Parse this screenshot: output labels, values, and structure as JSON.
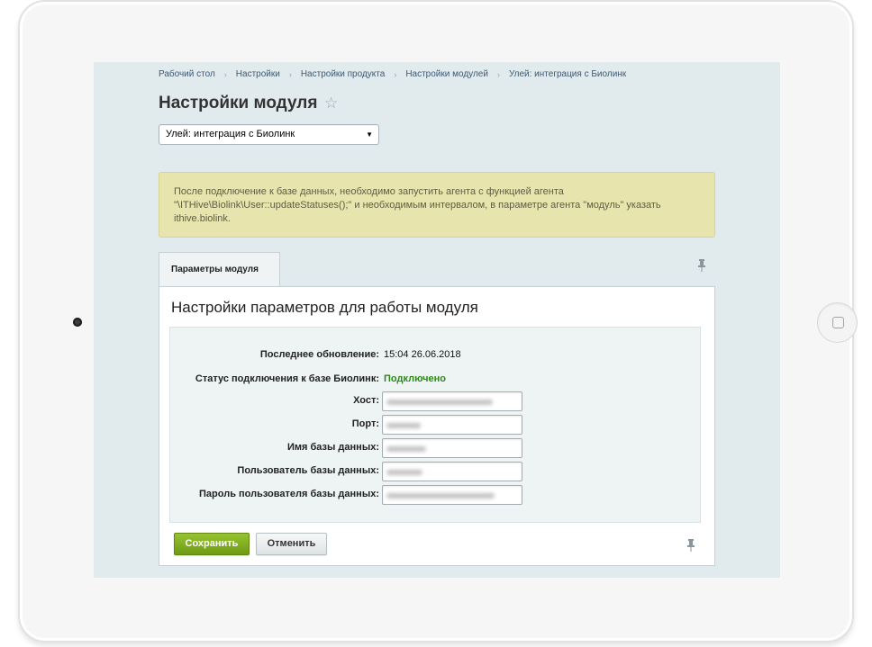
{
  "breadcrumb": {
    "items": [
      "Рабочий стол",
      "Настройки",
      "Настройки продукта",
      "Настройки модулей",
      "Улей: интеграция с Биолинк"
    ],
    "separator": "›"
  },
  "page": {
    "title": "Настройки модуля",
    "star_icon": "☆"
  },
  "module_select": {
    "value": "Улей: интеграция с Биолинк",
    "arrow": "▼"
  },
  "notice": {
    "text": "После подключение к базе данных, необходимо запустить агента с функцией агента \"\\ITHive\\Biolink\\User::updateStatuses();\" и необходимым интервалом, в параметре агента \"модуль\" указать ithive.biolink."
  },
  "tabs": [
    {
      "label": "Параметры модуля"
    }
  ],
  "panel": {
    "title": "Настройки параметров для работы модуля"
  },
  "form": {
    "last_update": {
      "label": "Последнее обновление:",
      "value": "15:04 26.06.2018"
    },
    "status": {
      "label": "Статус подключения к базе Биолинк:",
      "value": "Подключено"
    },
    "host": {
      "label": "Хост:",
      "value": ""
    },
    "port": {
      "label": "Порт:",
      "value": ""
    },
    "db_name": {
      "label": "Имя базы данных:",
      "value": ""
    },
    "db_user": {
      "label": "Пользователь базы данных:",
      "value": ""
    },
    "db_password": {
      "label": "Пароль пользователя базы данных:",
      "value": ""
    }
  },
  "buttons": {
    "save": "Сохранить",
    "cancel": "Отменить"
  },
  "colors": {
    "screen_bg": "#e1eaed",
    "notice_bg": "#e7e5ad",
    "status_ok": "#2b8a17",
    "save_button": "#7aa81b"
  }
}
